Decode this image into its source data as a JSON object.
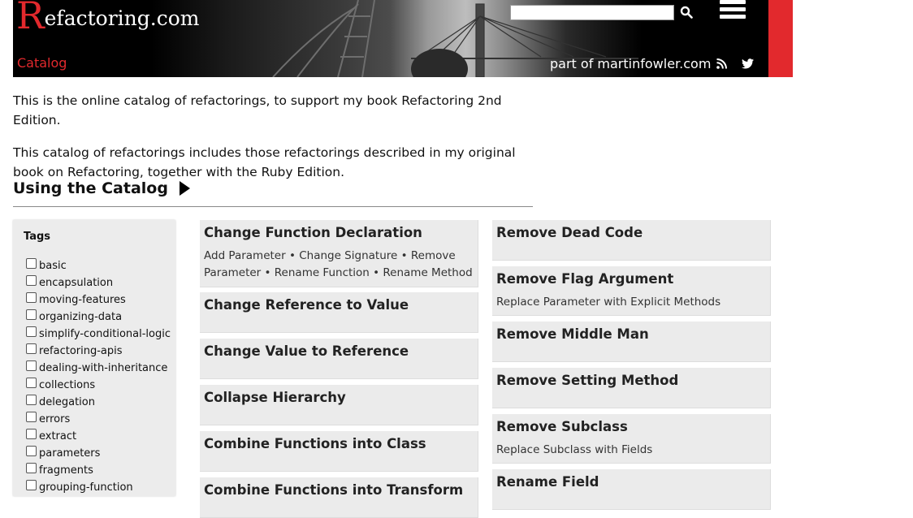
{
  "header": {
    "logo_initial": "R",
    "logo_rest": "efactoring.com",
    "catalog_link": "Catalog",
    "search_placeholder": "",
    "part_of_link": "part of martinfowler.com",
    "rss_icon": "rss-icon",
    "twitter_icon": "twitter-icon",
    "menu_icon": "hamburger-menu-icon",
    "search_icon": "search-icon",
    "colors": {
      "brand_red": "#e2292d",
      "banner_bg": "#000000"
    }
  },
  "intro": {
    "paragraph1": "This is the online catalog of refactorings, to support my book Refactoring 2nd Edition.",
    "paragraph2": "This catalog of refactorings includes those refactorings described in my original book on Refactoring, together with the Ruby Edition."
  },
  "section": {
    "heading": "Using the Catalog"
  },
  "tags": {
    "title": "Tags",
    "items": [
      "basic",
      "encapsulation",
      "moving-features",
      "organizing-data",
      "simplify-conditional-logic",
      "refactoring-apis",
      "dealing-with-inheritance",
      "collections",
      "delegation",
      "errors",
      "extract",
      "parameters",
      "fragments",
      "grouping-function"
    ]
  },
  "refactorings": {
    "left_column": [
      {
        "title": "Change Function Declaration",
        "aliases": "Add Parameter • Change Signature • Remove Parameter • Rename Function • Rename Method"
      },
      {
        "title": "Change Reference to Value",
        "aliases": ""
      },
      {
        "title": "Change Value to Reference",
        "aliases": ""
      },
      {
        "title": "Collapse Hierarchy",
        "aliases": ""
      },
      {
        "title": "Combine Functions into Class",
        "aliases": ""
      },
      {
        "title": "Combine Functions into Transform",
        "aliases": ""
      }
    ],
    "right_column": [
      {
        "title": "Remove Dead Code",
        "aliases": ""
      },
      {
        "title": "Remove Flag Argument",
        "aliases": "Replace Parameter with Explicit Methods"
      },
      {
        "title": "Remove Middle Man",
        "aliases": ""
      },
      {
        "title": "Remove Setting Method",
        "aliases": ""
      },
      {
        "title": "Remove Subclass",
        "aliases": "Replace Subclass with Fields"
      },
      {
        "title": "Rename Field",
        "aliases": ""
      }
    ]
  }
}
